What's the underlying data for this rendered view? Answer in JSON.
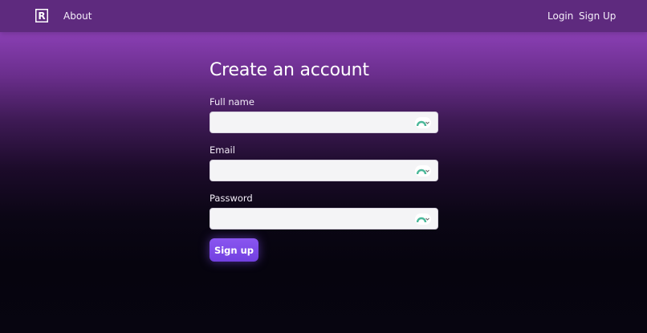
{
  "nav": {
    "logo_letter": "R",
    "about": "About",
    "login": "Login",
    "signup": "Sign Up"
  },
  "form": {
    "title": "Create an account",
    "fields": [
      {
        "label": "Full name",
        "value": "",
        "placeholder": ""
      },
      {
        "label": "Email",
        "value": "",
        "placeholder": ""
      },
      {
        "label": "Password",
        "value": "",
        "placeholder": ""
      }
    ],
    "submit_label": "Sign up"
  },
  "icons": {
    "logo": "brand-logo-icon",
    "field_addon": "password-manager-icon"
  },
  "colors": {
    "navbar": "#5e2a7e",
    "accent_button": "#7b4be6",
    "addon_icon": "#4cb89a"
  }
}
